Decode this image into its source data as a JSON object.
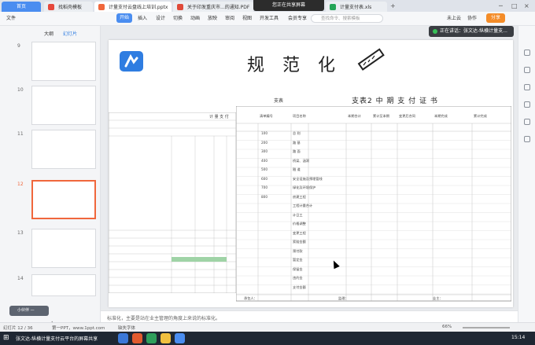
{
  "tabs": {
    "home": "首页",
    "items": [
      {
        "label": "找稻壳模板",
        "color": "#e6483c"
      },
      {
        "label": "计量支付云盘线上培训.pptx",
        "color": "#f0673c"
      },
      {
        "label": "关于印发重庆市...的通知.PDF",
        "color": "#e04a3a"
      },
      {
        "label": "计量支付表.xls",
        "color": "#24a557"
      }
    ],
    "banner": "您正在共享屏幕"
  },
  "menus": [
    "文件",
    "开始",
    "插入",
    "设计",
    "切换",
    "动画",
    "放映",
    "审阅",
    "视图",
    "开发工具",
    "会员专享"
  ],
  "active_menu": "开始",
  "search_placeholder": "查找命令、搜索模板",
  "toolbar_right": {
    "cloud": "未上云",
    "collab": "协作",
    "share": "分享"
  },
  "left_panel": {
    "tab_outline": "大纲",
    "tab_slides": "幻灯片",
    "slide_numbers": [
      "9",
      "10",
      "11",
      "12",
      "13",
      "14"
    ],
    "selected": "12",
    "mini_user": "小伙伴 —",
    "add_icon": "+"
  },
  "speaking": "正在讲话：张文达-纵横计量支...",
  "slide": {
    "title": "规 范 化",
    "left_sheet_label": "计 量 支 付",
    "appendix": "支表",
    "cert_title": "支表2 中 期 支 付 证 书",
    "header_cols": [
      "清单编号",
      "项目名称",
      "本期合计",
      "累计至本期",
      "变更后合同",
      "本期完成",
      "累计完成",
      "至本期末完成"
    ],
    "rows": [
      {
        "code": "100",
        "name": "总 则"
      },
      {
        "code": "200",
        "name": "路 基"
      },
      {
        "code": "300",
        "name": "路 面"
      },
      {
        "code": "400",
        "name": "桥梁、涵洞"
      },
      {
        "code": "500",
        "name": "隧 道"
      },
      {
        "code": "600",
        "name": "安全设施及预埋管线"
      },
      {
        "code": "700",
        "name": "绿化及环境保护"
      },
      {
        "code": "800",
        "name": "房建工程"
      },
      {
        "code": "",
        "name": "工程计量合计"
      },
      {
        "code": "",
        "name": "计日工"
      },
      {
        "code": "",
        "name": "价格调整"
      },
      {
        "code": "",
        "name": "变更工程"
      },
      {
        "code": "",
        "name": "索赔金额"
      },
      {
        "code": "",
        "name": "预付款"
      },
      {
        "code": "",
        "name": "暂定金"
      },
      {
        "code": "",
        "name": "保留金"
      },
      {
        "code": "",
        "name": "违约金"
      },
      {
        "code": "",
        "name": "支付金额"
      }
    ],
    "sign": [
      "承包人：",
      "监理：",
      "业主："
    ]
  },
  "notes": "标准化，主要是站在业主管理的角度上来说的标准化。",
  "status": {
    "page": "幻灯片 12 / 36",
    "theme": "第一PPT，www.1ppt.com",
    "font": "缺失字体",
    "zoom": "66%"
  },
  "taskbar": {
    "app": "张文达-纵横计量支付云平台的屏幕共享",
    "time": "15:14"
  }
}
